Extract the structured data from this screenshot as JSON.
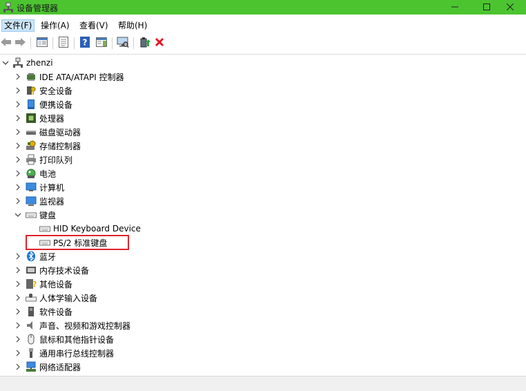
{
  "window": {
    "title": "设备管理器",
    "controls": [
      "minimize-icon",
      "maximize-icon",
      "close-icon"
    ]
  },
  "menu": {
    "items": [
      {
        "label": "文件(F)",
        "active": true
      },
      {
        "label": "操作(A)",
        "active": false
      },
      {
        "label": "查看(V)",
        "active": false
      },
      {
        "label": "帮助(H)",
        "active": false
      }
    ]
  },
  "toolbar": {
    "buttons": [
      "back-arrow-icon",
      "forward-arrow-icon",
      "show-hide-tree-icon",
      "properties-icon",
      "help-icon",
      "action-pane-icon",
      "scan-hardware-icon",
      "update-driver-icon",
      "uninstall-icon"
    ]
  },
  "tree": {
    "root": "zhenzi",
    "nodes": [
      {
        "label": "IDE ATA/ATAPI 控制器",
        "icon": "ide-controller-icon",
        "expanded": false
      },
      {
        "label": "安全设备",
        "icon": "security-key-icon",
        "expanded": false
      },
      {
        "label": "便携设备",
        "icon": "portable-device-icon",
        "expanded": false
      },
      {
        "label": "处理器",
        "icon": "processor-icon",
        "expanded": false
      },
      {
        "label": "磁盘驱动器",
        "icon": "disk-drive-icon",
        "expanded": false
      },
      {
        "label": "存储控制器",
        "icon": "storage-controller-icon",
        "expanded": false
      },
      {
        "label": "打印队列",
        "icon": "printer-icon",
        "expanded": false
      },
      {
        "label": "电池",
        "icon": "battery-icon",
        "expanded": false
      },
      {
        "label": "计算机",
        "icon": "computer-icon",
        "expanded": false
      },
      {
        "label": "监视器",
        "icon": "monitor-icon",
        "expanded": false
      },
      {
        "label": "键盘",
        "icon": "keyboard-icon",
        "expanded": true,
        "children": [
          {
            "label": "HID Keyboard Device",
            "icon": "keyboard-icon"
          },
          {
            "label": "PS/2 标准键盘",
            "icon": "keyboard-icon",
            "highlighted": true
          }
        ]
      },
      {
        "label": "蓝牙",
        "icon": "bluetooth-icon",
        "expanded": false
      },
      {
        "label": "内存技术设备",
        "icon": "memory-device-icon",
        "expanded": false
      },
      {
        "label": "其他设备",
        "icon": "unknown-device-icon",
        "expanded": false
      },
      {
        "label": "人体学输入设备",
        "icon": "hid-icon",
        "expanded": false
      },
      {
        "label": "软件设备",
        "icon": "software-device-icon",
        "expanded": false
      },
      {
        "label": "声音、视频和游戏控制器",
        "icon": "speaker-icon",
        "expanded": false
      },
      {
        "label": "鼠标和其他指针设备",
        "icon": "mouse-icon",
        "expanded": false
      },
      {
        "label": "通用串行总线控制器",
        "icon": "usb-icon",
        "expanded": false
      },
      {
        "label": "网络适配器",
        "icon": "network-adapter-icon",
        "expanded": false
      }
    ]
  },
  "colors": {
    "titlebar": "#4cc430",
    "highlight_border": "#e0222a",
    "uninstall_x": "#e81123"
  }
}
